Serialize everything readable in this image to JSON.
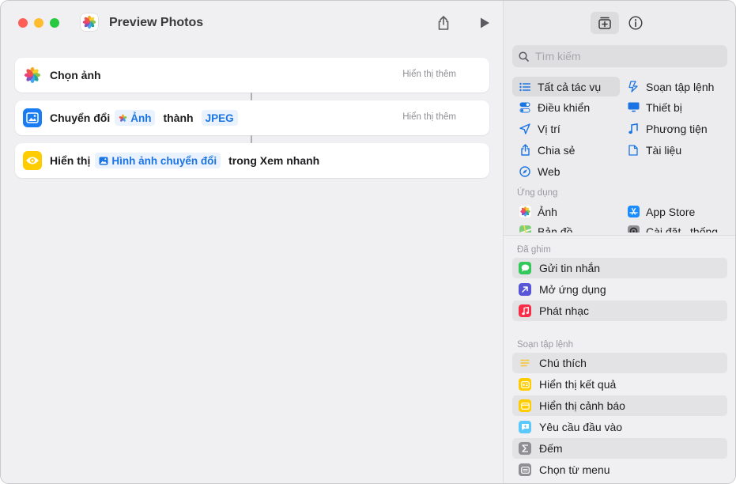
{
  "window": {
    "title": "Preview Photos"
  },
  "colors": {
    "accent": "#1b74e4",
    "token_bg": "#eaf2fd",
    "quicklook_yellow": "#ffcc00",
    "photos_blue": "#1a7cf2"
  },
  "actions": [
    {
      "name": "choose-photos",
      "label": "Chọn ảnh",
      "more": "Hiển thị thêm"
    },
    {
      "name": "convert-image",
      "label": "Chuyển đổi",
      "token_input": "Ảnh",
      "joiner": "thành",
      "token_format": "JPEG",
      "more": "Hiển thị thêm"
    },
    {
      "name": "quick-look",
      "label": "Hiển thị",
      "token_input": "Hình ảnh chuyển đổi",
      "suffix": "trong Xem nhanh"
    }
  ],
  "library": {
    "search_placeholder": "Tìm kiếm",
    "categories_left": [
      "Tất cả tác vụ",
      "Điều khiển",
      "Vị trí",
      "Chia sẻ",
      "Web"
    ],
    "categories_right": [
      "Soạn tập lệnh",
      "Thiết bị",
      "Phương tiện",
      "Tài liệu"
    ],
    "apps_header": "Ứng dụng",
    "apps": [
      "Ảnh",
      "App Store",
      "Bản đồ",
      "Cài đặt...thống"
    ],
    "pinned_header": "Đã ghim",
    "pinned": [
      "Gửi tin nhắn",
      "Mở ứng dụng",
      "Phát nhạc"
    ],
    "scripting_header": "Soạn tập lệnh",
    "scripting": [
      "Chú thích",
      "Hiển thị kết quả",
      "Hiển thị cảnh báo",
      "Yêu cầu đầu vào",
      "Đếm",
      "Chọn từ menu"
    ]
  }
}
